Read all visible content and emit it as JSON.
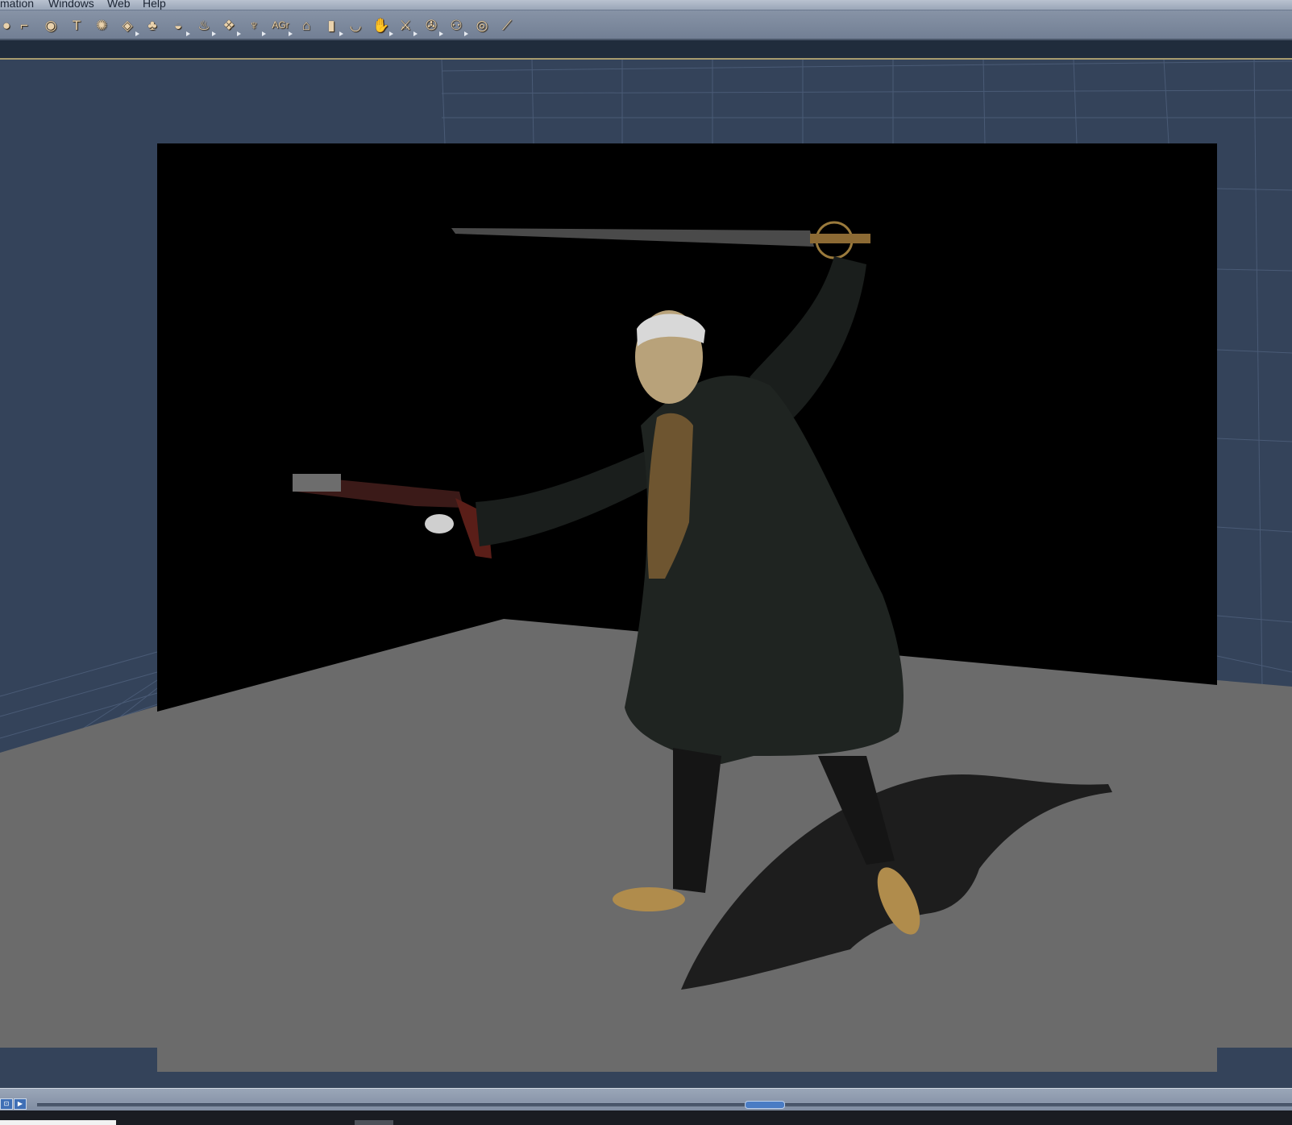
{
  "menubar": {
    "items": [
      {
        "label": "mation"
      },
      {
        "label": "Windows"
      },
      {
        "label": "Web"
      },
      {
        "label": "Help"
      }
    ]
  },
  "toolbar": {
    "tools": [
      {
        "icon": "partial-tool-icon",
        "glyph": "●",
        "flyout": false
      },
      {
        "icon": "bone-tool-icon",
        "glyph": "⌐",
        "flyout": false
      },
      {
        "icon": "eye-tool-icon",
        "glyph": "◉",
        "flyout": false
      },
      {
        "icon": "text-tool-icon",
        "glyph": "T",
        "flyout": false
      },
      {
        "icon": "particle-tool-icon",
        "glyph": "✺",
        "flyout": false
      },
      {
        "icon": "plane-tool-icon",
        "glyph": "◈",
        "flyout": true
      },
      {
        "icon": "tree-tool-icon",
        "glyph": "♣",
        "flyout": false
      },
      {
        "icon": "lips-tool-icon",
        "glyph": "◒",
        "flyout": true
      },
      {
        "icon": "fire-tool-icon",
        "glyph": "♨",
        "flyout": true
      },
      {
        "icon": "terrain-tool-icon",
        "glyph": "❖",
        "flyout": true
      },
      {
        "icon": "figure-tool-icon",
        "glyph": "♆",
        "flyout": true
      },
      {
        "icon": "agr-tool-icon",
        "glyph": "",
        "text": "AGr",
        "flyout": true
      },
      {
        "icon": "house-tool-icon",
        "glyph": "⌂",
        "flyout": false
      },
      {
        "icon": "cylinder-tool-icon",
        "glyph": "▮",
        "flyout": true
      },
      {
        "icon": "bowl-tool-icon",
        "glyph": "◡",
        "flyout": false
      },
      {
        "icon": "hand-tool-icon",
        "glyph": "✋",
        "flyout": true
      },
      {
        "icon": "sword-tool-icon",
        "glyph": "⚔",
        "flyout": true
      },
      {
        "icon": "camera-tool-icon",
        "glyph": "✇",
        "flyout": true
      },
      {
        "icon": "hierarchy-tool-icon",
        "glyph": "⚇",
        "flyout": true
      },
      {
        "icon": "target-tool-icon",
        "glyph": "◎",
        "flyout": false
      },
      {
        "icon": "bone-single-tool-icon",
        "glyph": "⟋",
        "flyout": false
      }
    ]
  },
  "timeline": {
    "buttons": [
      {
        "icon": "delete-key-icon",
        "glyph": "⊡"
      },
      {
        "icon": "play-icon",
        "glyph": "▶"
      }
    ]
  },
  "colors": {
    "viewport_bg": "#34435a",
    "grid_line": "#4a5b76",
    "floor": "#6b6b6b",
    "render_bg": "#000000"
  }
}
